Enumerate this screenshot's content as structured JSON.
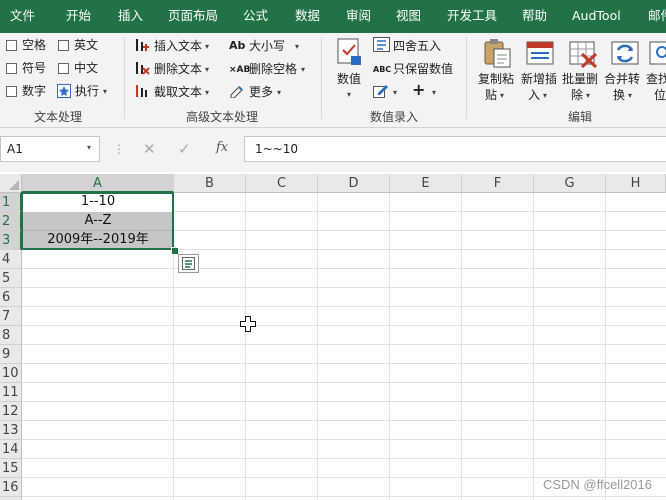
{
  "tabs": [
    {
      "label": "文件",
      "active": false
    },
    {
      "label": "开始",
      "active": false
    },
    {
      "label": "插入",
      "active": false
    },
    {
      "label": "页面布局",
      "active": false
    },
    {
      "label": "公式",
      "active": false
    },
    {
      "label": "数据",
      "active": false
    },
    {
      "label": "审阅",
      "active": false
    },
    {
      "label": "视图",
      "active": false
    },
    {
      "label": "开发工具",
      "active": false
    },
    {
      "label": "帮助",
      "active": false
    },
    {
      "label": "AudTool",
      "active": true
    },
    {
      "label": "邮件",
      "active": false
    }
  ],
  "ribbon": {
    "text_group": {
      "label": "文本处理",
      "checkboxes": [
        {
          "label": "空格"
        },
        {
          "label": "英文"
        },
        {
          "label": "符号"
        },
        {
          "label": "中文"
        },
        {
          "label": "数字"
        }
      ],
      "execute_label": "执行"
    },
    "advanced_group": {
      "label": "高级文本处理",
      "insert_text": "插入文本",
      "delete_text": "删除文本",
      "cut_text": "截取文本",
      "case": "大小写",
      "delete_spaces": "删除空格",
      "more": "更多"
    },
    "entry_group": {
      "label": "数值录入",
      "value": "数值",
      "round": "四舍五入",
      "keep_value": "只保留数值"
    },
    "edit_group": {
      "label": "编辑",
      "copy_paste": [
        "复制粘",
        "贴"
      ],
      "new_insert": [
        "新增插",
        "入"
      ],
      "batch_delete": [
        "批量删",
        "除"
      ],
      "merge_convert": [
        "合并转",
        "换"
      ],
      "find_locate": [
        "查找",
        "位"
      ]
    }
  },
  "formula_bar": {
    "name_box": "A1",
    "formula": "1~~10"
  },
  "sheet": {
    "columns": [
      "A",
      "B",
      "C",
      "D",
      "E",
      "F",
      "G",
      "H"
    ],
    "rows": [
      "1",
      "2",
      "3",
      "4",
      "5",
      "6",
      "7",
      "8",
      "9",
      "10",
      "11",
      "12",
      "13",
      "14",
      "15",
      "16",
      "17"
    ],
    "cells": {
      "A1": "1--10",
      "A2": "A--Z",
      "A3": "2009年--2019年"
    }
  },
  "watermark": "CSDN @ffcell2016",
  "colors": {
    "accent": "#217346",
    "selection_fill": "#c6c6c6",
    "selection_border": "#217346"
  }
}
